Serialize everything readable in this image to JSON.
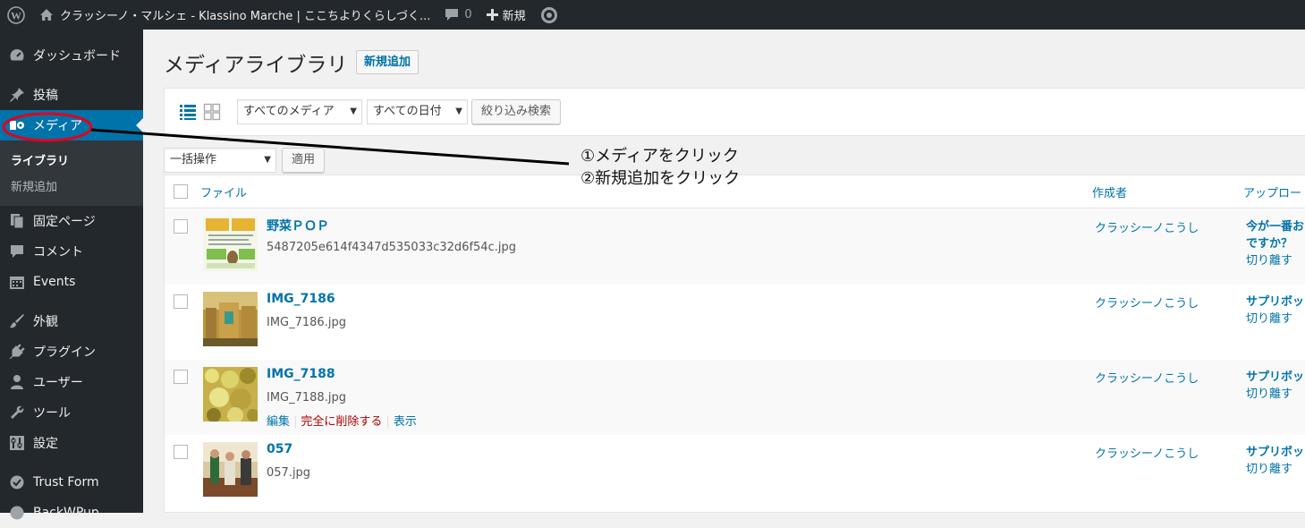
{
  "adminbar": {
    "site_title": "クラッシーノ・マルシェ - Klassino Marche | ここちよりくらしづく...",
    "comment_count": "0",
    "new_label": "新規"
  },
  "sidebar": {
    "items": [
      {
        "label": "ダッシュボード",
        "icon": "dashboard-icon"
      },
      {
        "label": "投稿",
        "icon": "pushpin-icon"
      },
      {
        "label": "メディア",
        "icon": "media-icon"
      },
      {
        "label": "固定ページ",
        "icon": "page-icon"
      },
      {
        "label": "コメント",
        "icon": "comment-icon"
      },
      {
        "label": "Events",
        "icon": "calendar-icon"
      },
      {
        "label": "外観",
        "icon": "brush-icon"
      },
      {
        "label": "プラグイン",
        "icon": "plugin-icon"
      },
      {
        "label": "ユーザー",
        "icon": "user-icon"
      },
      {
        "label": "ツール",
        "icon": "wrench-icon"
      },
      {
        "label": "設定",
        "icon": "settings-icon"
      },
      {
        "label": "Trust Form",
        "icon": "form-icon"
      },
      {
        "label": "BackWPup",
        "icon": "backup-icon"
      }
    ],
    "submenu": {
      "library": "ライブラリ",
      "add_new": "新規追加"
    }
  },
  "main": {
    "title": "メディアライブラリ",
    "add_new": "新規追加",
    "filters": {
      "media_type": "すべてのメディア",
      "date": "すべての日付",
      "filter_button": "絞り込み検索"
    },
    "bulk": {
      "select": "一括操作",
      "apply": "適用"
    },
    "columns": {
      "file": "ファイル",
      "author": "作成者",
      "uploaded_to": "アップロー"
    },
    "rows": [
      {
        "title": "野菜ＰＯＰ",
        "filename": "5487205e614f4347d535033c32d6f54c.jpg",
        "author": "クラッシーノこうし",
        "attached_line1": "今が一番お",
        "attached_line2": "ですか？",
        "detach": "切り離す"
      },
      {
        "title": "IMG_7186",
        "filename": "IMG_7186.jpg",
        "author": "クラッシーノこうし",
        "attached_line1": "サプリボッ",
        "attached_line2": "",
        "detach": "切り離す"
      },
      {
        "title": "IMG_7188",
        "filename": "IMG_7188.jpg",
        "author": "クラッシーノこうし",
        "attached_line1": "サプリボッ",
        "attached_line2": "",
        "detach": "切り離す",
        "actions": {
          "edit": "編集",
          "delete": "完全に削除する",
          "view": "表示"
        }
      },
      {
        "title": "057",
        "filename": "057.jpg",
        "author": "クラッシーノこうし",
        "attached_line1": "サプリボッ",
        "attached_line2": "",
        "detach": "切り離す"
      }
    ]
  },
  "annotation": {
    "line1": "①メディアをクリック",
    "line2": "②新規追加をクリック",
    "color": "#e3001b"
  }
}
